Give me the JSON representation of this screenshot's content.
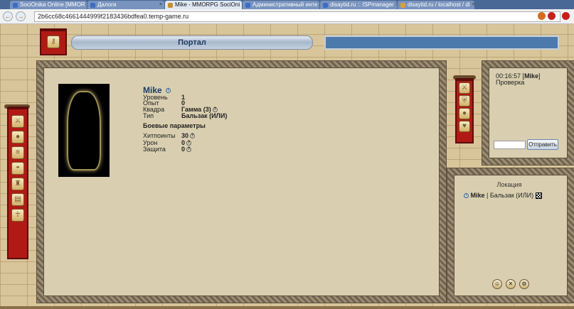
{
  "browser": {
    "tabs": [
      {
        "label": "SociOnika Online [MMOR",
        "active": false
      },
      {
        "label": "Далоги",
        "active": false
      },
      {
        "label": "Mike - MMORPG SociOni",
        "active": true
      },
      {
        "label": "Административный инте",
        "active": false
      },
      {
        "label": "disaytid.ru :: ISPmanager",
        "active": false
      },
      {
        "label": "disaytid.ru / localhost / di",
        "active": false
      }
    ],
    "url": "2b6cc68c4661444999f2183436bdfea0.temp-game.ru",
    "back_glyph": "←",
    "forward_glyph": "→"
  },
  "header": {
    "title": "Портал"
  },
  "sidebar": {
    "icons": [
      "helmet-icon",
      "coin-icon",
      "scroll-icon",
      "bag-icon",
      "chess-icon",
      "coins-stack-icon",
      "figure-icon"
    ]
  },
  "right_banner": {
    "icons": [
      "helmet-icon",
      "shield-icon",
      "coin-icon",
      "heart-icon"
    ]
  },
  "profile": {
    "name": "Mike",
    "rows": [
      {
        "label": "Уровень",
        "value": "1"
      },
      {
        "label": "Опыт",
        "value": "0"
      },
      {
        "label": "Квадра",
        "value": "Гамма (3)"
      },
      {
        "label": "Тип",
        "value": "Бальзак (ИЛИ)"
      }
    ],
    "combat_title": "Боевые параметры",
    "combat": [
      {
        "label": "Хитпоинты",
        "value": "30"
      },
      {
        "label": "Урон",
        "value": "0"
      },
      {
        "label": "Защита",
        "value": "0"
      }
    ]
  },
  "chat": {
    "time": "00:16:57",
    "user": "Mike",
    "message": "Проверка",
    "send_label": "Отправить",
    "input_value": ""
  },
  "location": {
    "title": "Локация",
    "player_name": "Mike",
    "player_type": "Бальзак (ИЛИ)"
  },
  "colors": {
    "banner": "#b11a14",
    "header_blue": "#4d7aac",
    "panel": "#d9cfb0"
  }
}
